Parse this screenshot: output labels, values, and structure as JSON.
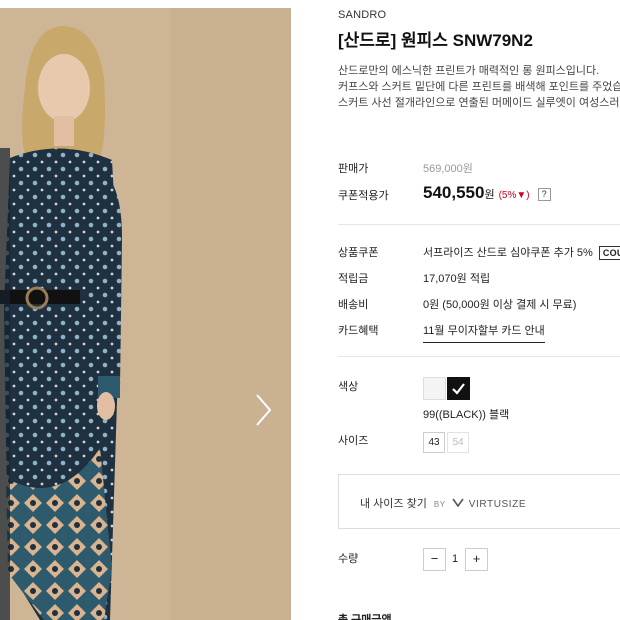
{
  "product": {
    "brand": "SANDRO",
    "title": "[산드로] 원피스 SNW79N2",
    "description": [
      "산드로만의 에스닉한 프린트가 매력적인 롱 원피스입니다.",
      "커프스와 스커트 밑단에 다른 프린트를 배색해 포인트를 주었습니",
      "스커트 사선 절개라인으로 연출된 머메이드 실루엣이 여성스러운"
    ]
  },
  "price": {
    "sale_label": "판매가",
    "sale_value": "569,000원",
    "coupon_label": "쿠폰적용가",
    "coupon_value": "540,550",
    "coupon_unit": "원",
    "discount": "(5%▼)",
    "help": "?"
  },
  "benefits": {
    "coupon_label": "상품쿠폰",
    "coupon_text": "서프라이즈 산드로 심야쿠폰 추가 5%",
    "coupon_tag": "COUPON",
    "points_label": "적립금",
    "points_value": "17,070원 적립",
    "shipping_label": "배송비",
    "shipping_value": "0원 (50,000원 이상 결제 시 무료)",
    "card_label": "카드혜택",
    "card_value": "11월 무이자할부 카드 안내"
  },
  "options": {
    "color_label": "색상",
    "selected_color": "99((BLACK)) 블랙",
    "size_label": "사이즈",
    "sizes": [
      "43",
      "54"
    ],
    "virtusize_label": "내 사이즈 찾기",
    "virtusize_by": "BY",
    "virtusize_logo": "VIRTUSIZE"
  },
  "quantity": {
    "label": "수량",
    "minus": "−",
    "value": "1",
    "plus": "+"
  },
  "total": {
    "label": "총 구매금액"
  },
  "colors": {
    "photo_background": "#cdb596",
    "discount_red": "#d0021b",
    "dress_navy": "#1f3040"
  },
  "icons": {
    "carousel_next": "chevron-right-icon",
    "virtusize_logo": "virtusize-v-icon"
  }
}
